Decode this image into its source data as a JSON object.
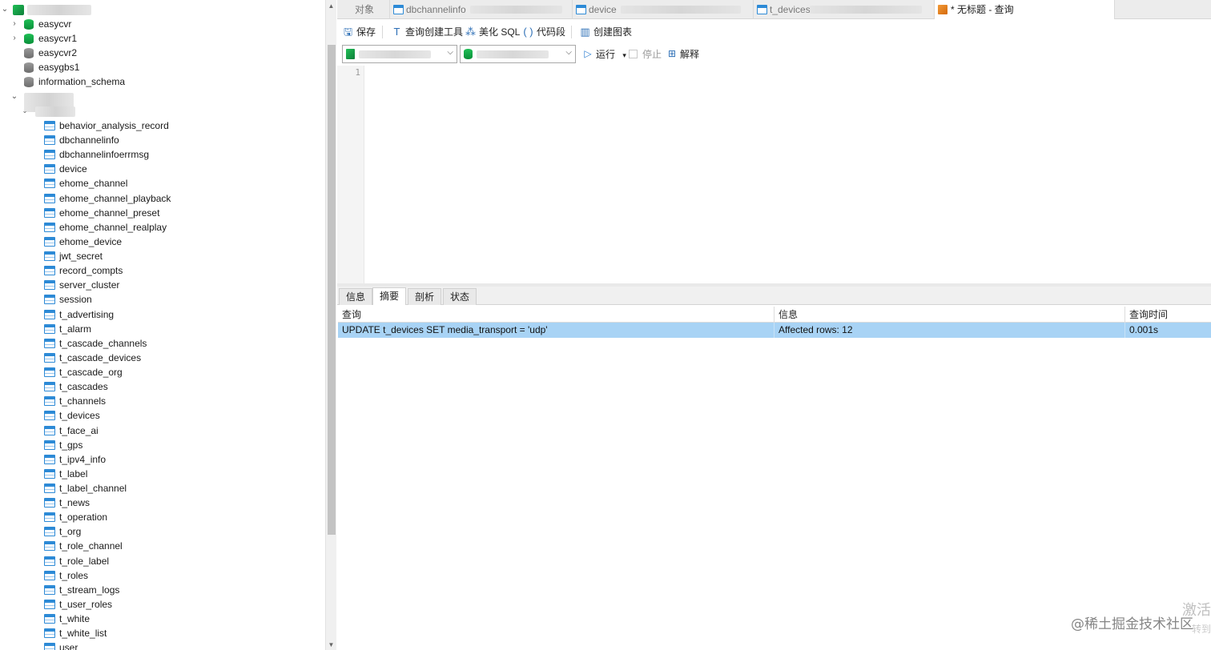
{
  "navigator": {
    "databases": [
      {
        "name": "easycvr",
        "color": "green"
      },
      {
        "name": "easycvr1",
        "color": "green"
      },
      {
        "name": "easycvr2",
        "color": "grey"
      },
      {
        "name": "easygbs1",
        "color": "grey"
      },
      {
        "name": "information_schema",
        "color": "grey"
      }
    ],
    "tables": [
      "behavior_analysis_record",
      "dbchannelinfo",
      "dbchannelinfoerrmsg",
      "device",
      "ehome_channel",
      "ehome_channel_playback",
      "ehome_channel_preset",
      "ehome_channel_realplay",
      "ehome_device",
      "jwt_secret",
      "record_compts",
      "server_cluster",
      "session",
      "t_advertising",
      "t_alarm",
      "t_cascade_channels",
      "t_cascade_devices",
      "t_cascade_org",
      "t_cascades",
      "t_channels",
      "t_devices",
      "t_face_ai",
      "t_gps",
      "t_ipv4_info",
      "t_label",
      "t_label_channel",
      "t_news",
      "t_operation",
      "t_org",
      "t_role_channel",
      "t_role_label",
      "t_roles",
      "t_stream_logs",
      "t_user_roles",
      "t_white",
      "t_white_list",
      "user"
    ]
  },
  "tabs": {
    "objects": "对象",
    "t1": "dbchannelinfo",
    "t2": "device",
    "t3": "t_devices",
    "query": "* 无标题 - 查询"
  },
  "toolbar": {
    "save": "保存",
    "query_builder": "查询创建工具",
    "beautify": "美化 SQL",
    "snippet": "代码段",
    "create_chart": "创建图表"
  },
  "runbar": {
    "run": "运行",
    "stop": "停止",
    "explain": "解释"
  },
  "editor": {
    "line1": "1"
  },
  "result_tabs": [
    "信息",
    "摘要",
    "剖析",
    "状态"
  ],
  "result_grid": {
    "headers": [
      "查询",
      "信息",
      "查询时间"
    ],
    "row": [
      "UPDATE t_devices SET media_transport = 'udp'",
      "Affected rows: 12",
      "0.001s"
    ]
  },
  "overlays": {
    "watermark": "@稀土掘金技术社区",
    "activate": "激活",
    "activate_sub": "转到"
  }
}
